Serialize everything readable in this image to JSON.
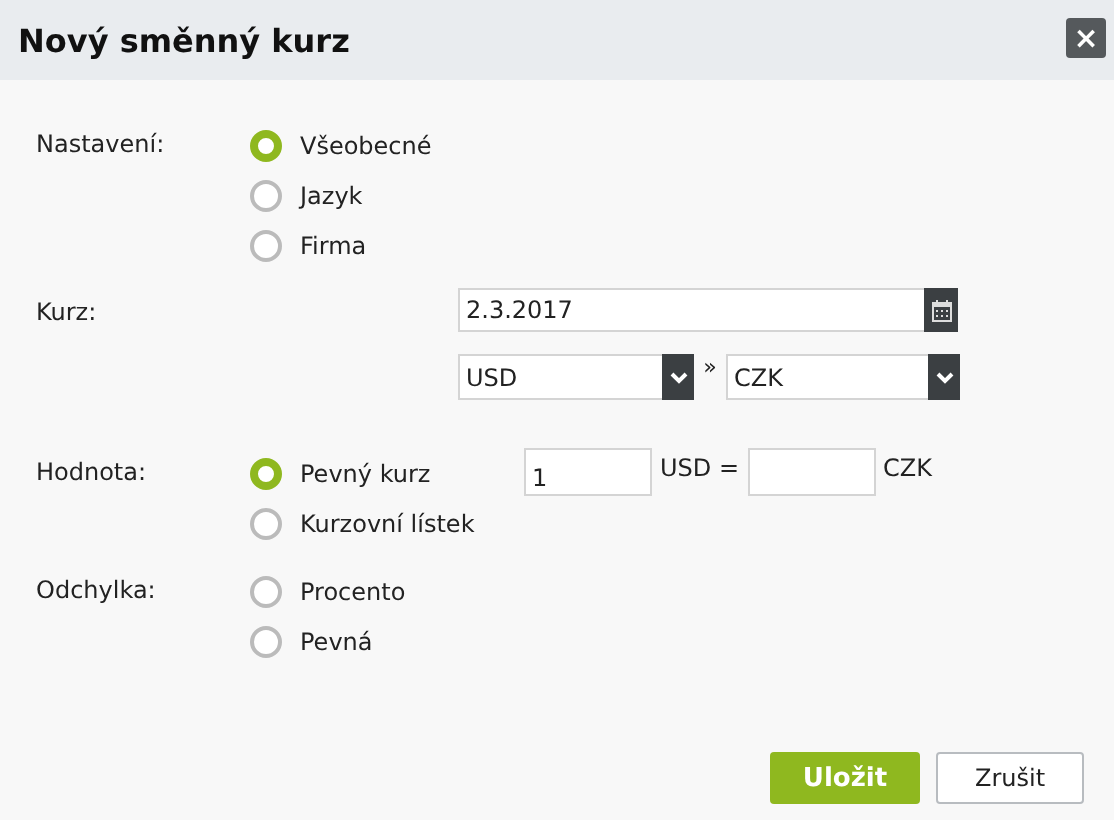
{
  "window": {
    "title": "Nový směnný kurz",
    "close": "×"
  },
  "settings": {
    "label": "Nastavení:",
    "options": [
      {
        "label": "Všeobecné",
        "selected": true
      },
      {
        "label": "Jazyk",
        "selected": false
      },
      {
        "label": "Firma",
        "selected": false
      }
    ]
  },
  "rate": {
    "label": "Kurz:",
    "date": "2.3.2017",
    "from_currency": "USD",
    "separator": "»",
    "to_currency": "CZK"
  },
  "value": {
    "label": "Hodnota:",
    "options": [
      {
        "label": "Pevný kurz",
        "selected": true
      },
      {
        "label": "Kurzovní lístek",
        "selected": false
      }
    ],
    "amount": "1",
    "from_text": "USD =",
    "to_text": "CZK"
  },
  "deviation": {
    "label": "Odchylka:",
    "options": [
      {
        "label": "Procento",
        "selected": false
      },
      {
        "label": "Pevná",
        "selected": false
      }
    ]
  },
  "buttons": [
    {
      "label": "Uložit",
      "kind": "primary"
    },
    {
      "label": "Zrušit",
      "kind": "secondary"
    }
  ]
}
